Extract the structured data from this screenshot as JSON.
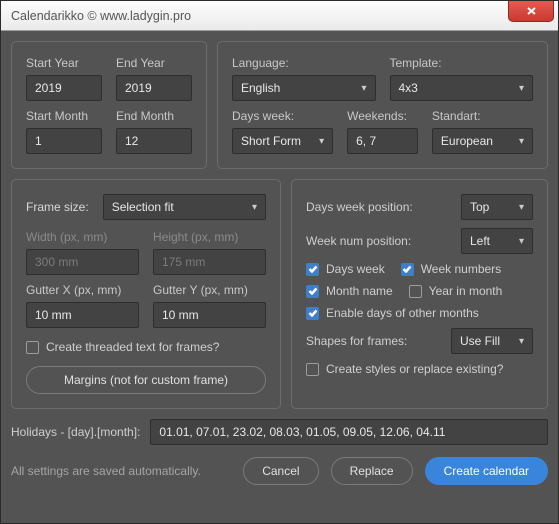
{
  "window": {
    "title": "Calendarikko © www.ladygin.pro"
  },
  "dates": {
    "startYearLabel": "Start Year",
    "startYear": "2019",
    "endYearLabel": "End Year",
    "endYear": "2019",
    "startMonthLabel": "Start Month",
    "startMonth": "1",
    "endMonthLabel": "End Month",
    "endMonth": "12"
  },
  "locale": {
    "languageLabel": "Language:",
    "language": "English",
    "templateLabel": "Template:",
    "template": "4x3",
    "daysWeekLabel": "Days week:",
    "daysWeek": "Short Form",
    "weekendsLabel": "Weekends:",
    "weekends": "6, 7",
    "standartLabel": "Standart:",
    "standart": "European"
  },
  "frame": {
    "sizeLabel": "Frame size:",
    "size": "Selection fit",
    "widthLabel": "Width (px, mm)",
    "width": "300 mm",
    "heightLabel": "Height (px, mm)",
    "height": "175 mm",
    "gutterXLabel": "Gutter X (px, mm)",
    "gutterX": "10 mm",
    "gutterYLabel": "Gutter Y (px, mm)",
    "gutterY": "10 mm",
    "threadedLabel": "Create threaded text for frames?",
    "marginsBtn": "Margins (not for custom frame)"
  },
  "options": {
    "daysWeekPosLabel": "Days week position:",
    "daysWeekPos": "Top",
    "weekNumPosLabel": "Week num position:",
    "weekNumPos": "Left",
    "cbDaysWeek": "Days week",
    "cbWeekNumbers": "Week numbers",
    "cbMonthName": "Month name",
    "cbYearInMonth": "Year in month",
    "cbOtherMonths": "Enable days of other months",
    "shapesLabel": "Shapes for frames:",
    "shapes": "Use Fill",
    "createStyles": "Create styles or replace existing?"
  },
  "holidays": {
    "label": "Holidays - [day].[month]:",
    "value": "01.01, 07.01, 23.02, 08.03, 01.05, 09.05, 12.06, 04.11"
  },
  "footer": {
    "message": "All settings are saved automatically.",
    "cancel": "Cancel",
    "replace": "Replace",
    "create": "Create calendar"
  }
}
